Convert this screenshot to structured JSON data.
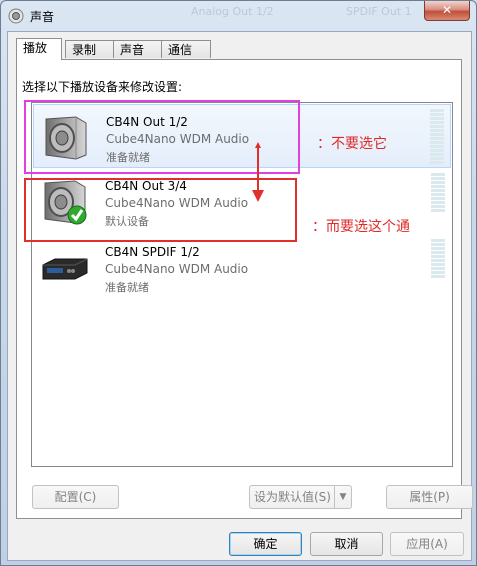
{
  "window": {
    "title": "声音",
    "close_label": "✕",
    "ghost_texts": [
      "Analog Out 1/2",
      "SPDIF Out 1"
    ]
  },
  "tabs": [
    {
      "label": "播放",
      "active": true
    },
    {
      "label": "录制",
      "active": false
    },
    {
      "label": "声音",
      "active": false
    },
    {
      "label": "通信",
      "active": false
    }
  ],
  "instruction": "选择以下播放设备来修改设置:",
  "devices": [
    {
      "name": "CB4N Out 1/2",
      "driver": "Cube4Nano WDM Audio",
      "status": "准备就绪",
      "icon": "speaker-icon",
      "selected": true
    },
    {
      "name": "CB4N Out 3/4",
      "driver": "Cube4Nano WDM Audio",
      "status": "默认设备",
      "icon": "speaker-default-icon",
      "selected": false
    },
    {
      "name": "CB4N SPDIF 1/2",
      "driver": "Cube4Nano WDM Audio",
      "status": "准备就绪",
      "icon": "spdif-receiver-icon",
      "selected": false
    }
  ],
  "annotations": {
    "note1": "：不要选它",
    "note2": "：而要选这个通",
    "colors": {
      "magenta": "#e23fe0",
      "red": "#e0302c"
    }
  },
  "buttons": {
    "configure": "配置(C)",
    "set_default": "设为默认值(S)",
    "properties": "属性(P)",
    "ok": "确定",
    "cancel": "取消",
    "apply": "应用(A)"
  }
}
